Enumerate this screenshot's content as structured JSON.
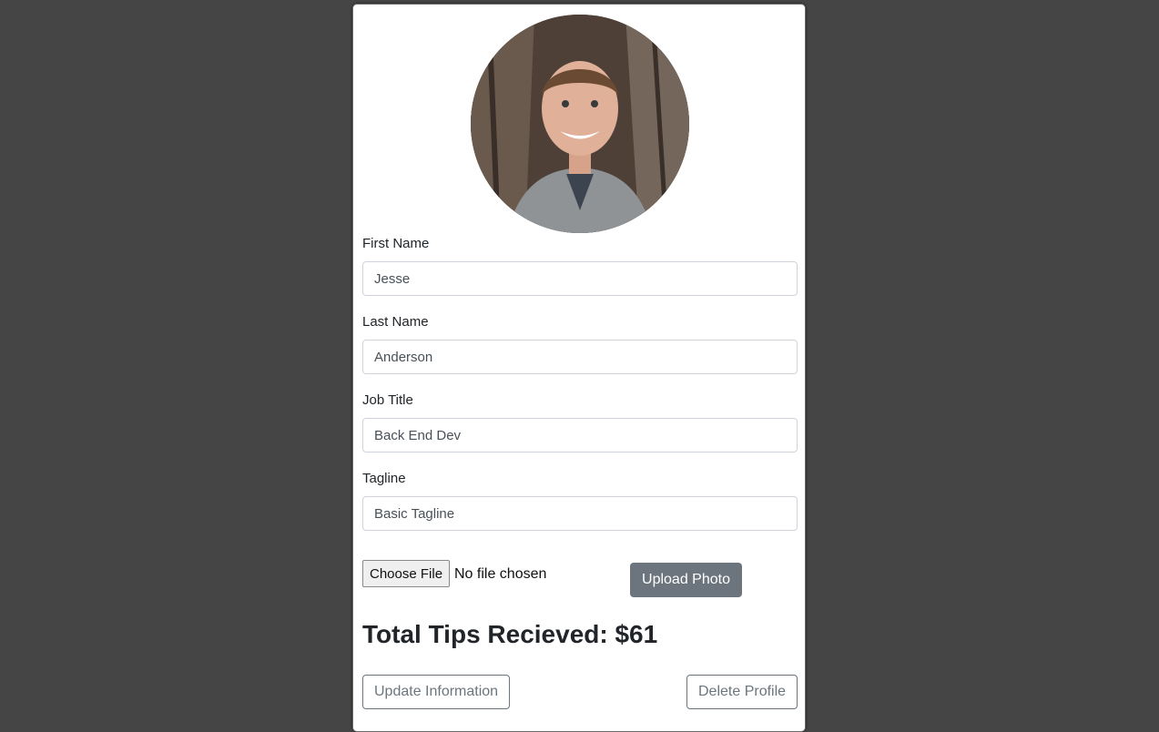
{
  "profile": {
    "avatar_alt": "profile photo"
  },
  "fields": [
    {
      "label": "First Name",
      "value": "Jesse"
    },
    {
      "label": "Last Name",
      "value": "Anderson"
    },
    {
      "label": "Job Title",
      "value": "Back End Dev"
    },
    {
      "label": "Tagline",
      "value": "Basic Tagline"
    }
  ],
  "upload": {
    "choose_label": "Choose File",
    "status": "No file chosen",
    "upload_label": "Upload Photo"
  },
  "tips": {
    "text": "Total Tips Recieved: $61"
  },
  "actions": {
    "update_label": "Update Information",
    "delete_label": "Delete Profile"
  },
  "colors": {
    "background": "#454545",
    "secondary": "#6c757d"
  }
}
